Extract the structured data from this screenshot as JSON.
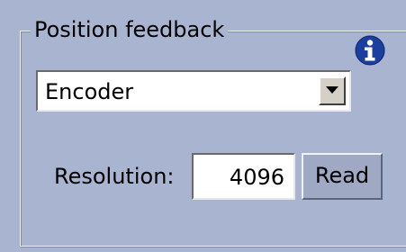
{
  "group": {
    "title": "Position feedback"
  },
  "info_icon": {
    "name": "info-icon",
    "color": "#1a3f9e"
  },
  "feedback_type": {
    "selected": "Encoder"
  },
  "resolution": {
    "label": "Resolution:",
    "value": "4096"
  },
  "read_button": {
    "label": "Read"
  }
}
